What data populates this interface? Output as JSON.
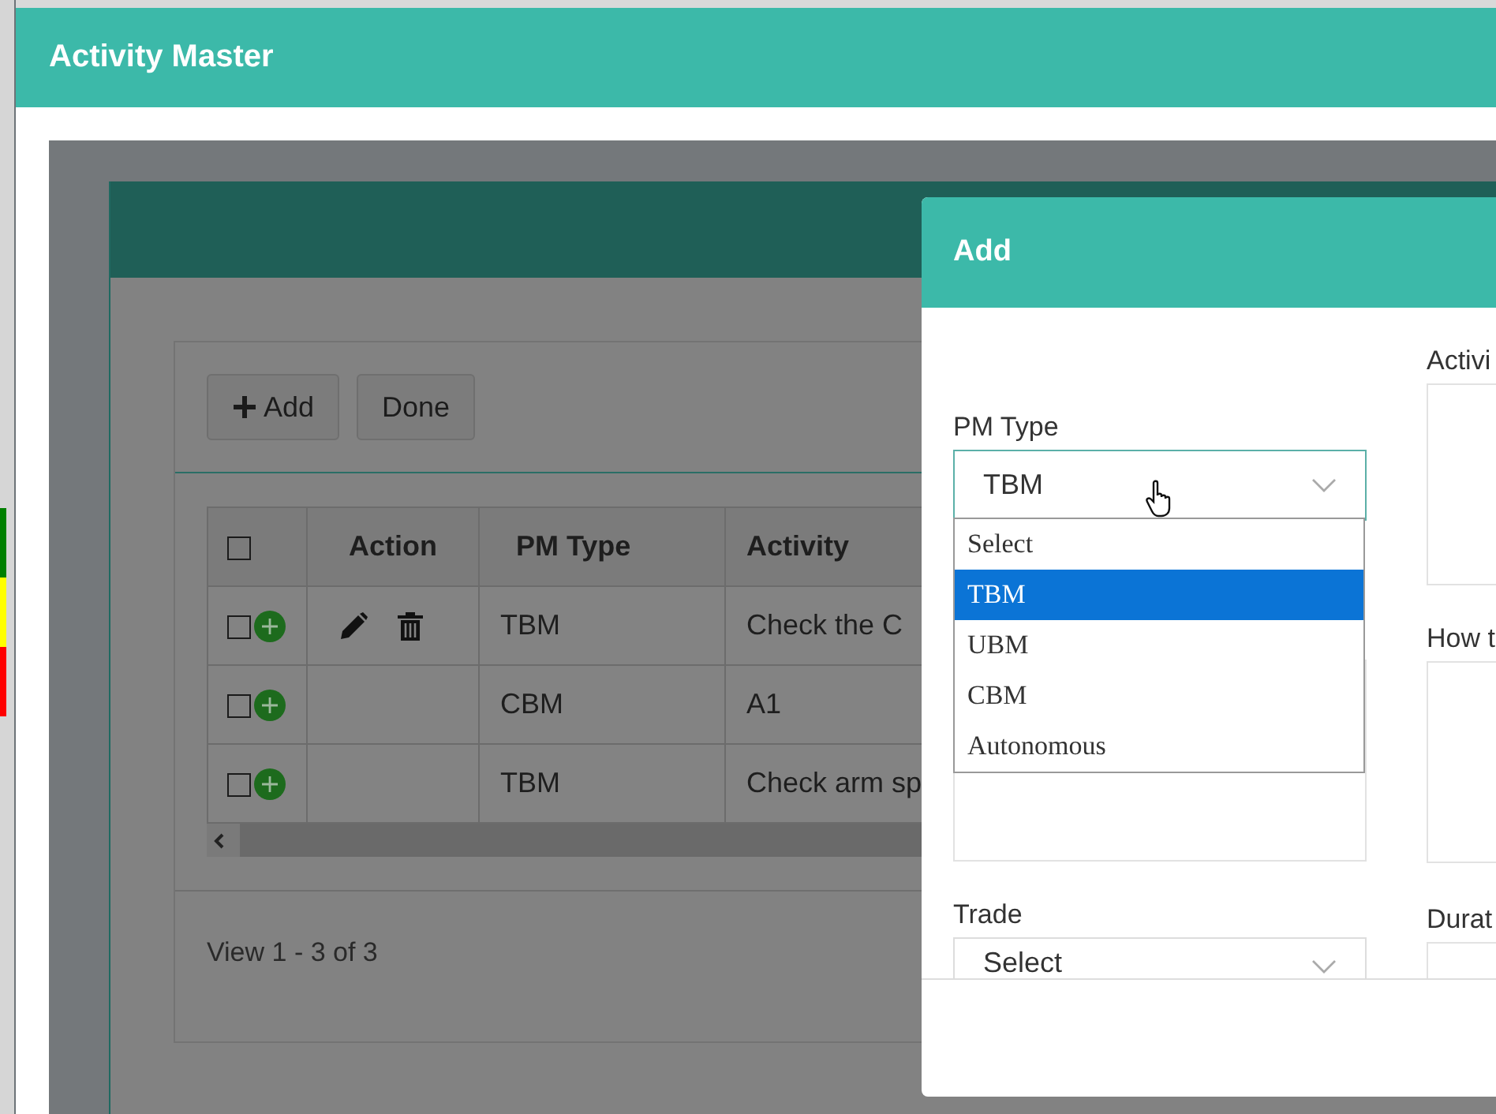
{
  "left_strip": [
    {
      "color": "#008000"
    },
    {
      "color": "#ffff00"
    },
    {
      "color": "#ff0000"
    }
  ],
  "window": {
    "title": "Activity Master"
  },
  "toolbar": {
    "buttons": [
      {
        "kind": "add",
        "label": "Add"
      },
      {
        "kind": "plain",
        "label": "Done"
      }
    ]
  },
  "table": {
    "select_all_checked": false,
    "columns": [
      "Action",
      "PM Type",
      "Activity"
    ],
    "rows": [
      {
        "checked": false,
        "show_actions": true,
        "pm_type": "TBM",
        "activity": "Check the C"
      },
      {
        "checked": false,
        "show_actions": false,
        "pm_type": "CBM",
        "activity": "A1"
      },
      {
        "checked": false,
        "show_actions": false,
        "pm_type": "TBM",
        "activity": "Check arm sp"
      }
    ]
  },
  "pager": {
    "text": "View 1 - 3 of 3"
  },
  "dialog": {
    "title": "Add",
    "pm_type": {
      "label": "PM Type",
      "value": "TBM",
      "options": [
        {
          "label": "Select",
          "selected": false
        },
        {
          "label": "TBM",
          "selected": true
        },
        {
          "label": "UBM",
          "selected": false
        },
        {
          "label": "CBM",
          "selected": false
        },
        {
          "label": "Autonomous",
          "selected": false
        }
      ]
    },
    "trade": {
      "label": "Trade",
      "value": "Select"
    },
    "activity": {
      "label": "Activi"
    },
    "how_to": {
      "label": "How t"
    },
    "duration": {
      "label": "Durat"
    }
  }
}
